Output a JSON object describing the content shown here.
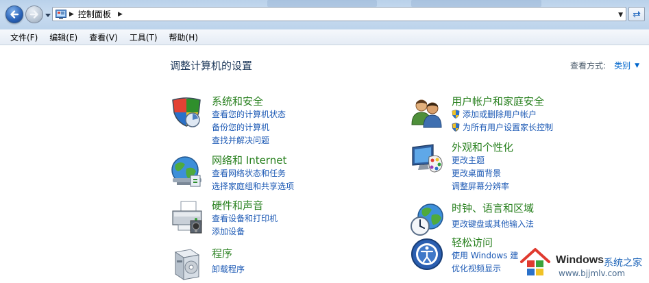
{
  "address": {
    "crumb": "控制面板"
  },
  "menu": [
    "文件(F)",
    "编辑(E)",
    "查看(V)",
    "工具(T)",
    "帮助(H)"
  ],
  "page": {
    "heading": "调整计算机的设置",
    "view_by_label": "查看方式:",
    "view_by_value": "类别"
  },
  "categories": [
    {
      "title": "系统和安全",
      "icon": "shield-icon",
      "links": [
        "查看您的计算机状态",
        "备份您的计算机",
        "查找并解决问题"
      ]
    },
    {
      "title": "网络和 Internet",
      "icon": "network-globe-icon",
      "links": [
        "查看网络状态和任务",
        "选择家庭组和共享选项"
      ]
    },
    {
      "title": "硬件和声音",
      "icon": "printer-icon",
      "links": [
        "查看设备和打印机",
        "添加设备"
      ]
    },
    {
      "title": "程序",
      "icon": "programs-box-icon",
      "links": [
        "卸载程序"
      ]
    },
    {
      "title": "用户帐户和家庭安全",
      "icon": "users-icon",
      "links": [
        "添加或删除用户帐户",
        "为所有用户设置家长控制"
      ]
    },
    {
      "title": "外观和个性化",
      "icon": "monitor-palette-icon",
      "links": [
        "更改主题",
        "更改桌面背景",
        "调整屏幕分辨率"
      ]
    },
    {
      "title": "时钟、语言和区域",
      "icon": "globe-clock-icon",
      "links": [
        "更改键盘或其他输入法"
      ]
    },
    {
      "title": "轻松访问",
      "icon": "ease-of-access-icon",
      "links": [
        "使用 Windows 建",
        "优化视频显示"
      ]
    }
  ],
  "watermark": {
    "brand": "Windows",
    "site": "系统之家",
    "url": "www.bjjmlv.com"
  },
  "colors": {
    "category_title": "#267f1c",
    "link": "#1d5ab5",
    "heading": "#1e395b"
  }
}
